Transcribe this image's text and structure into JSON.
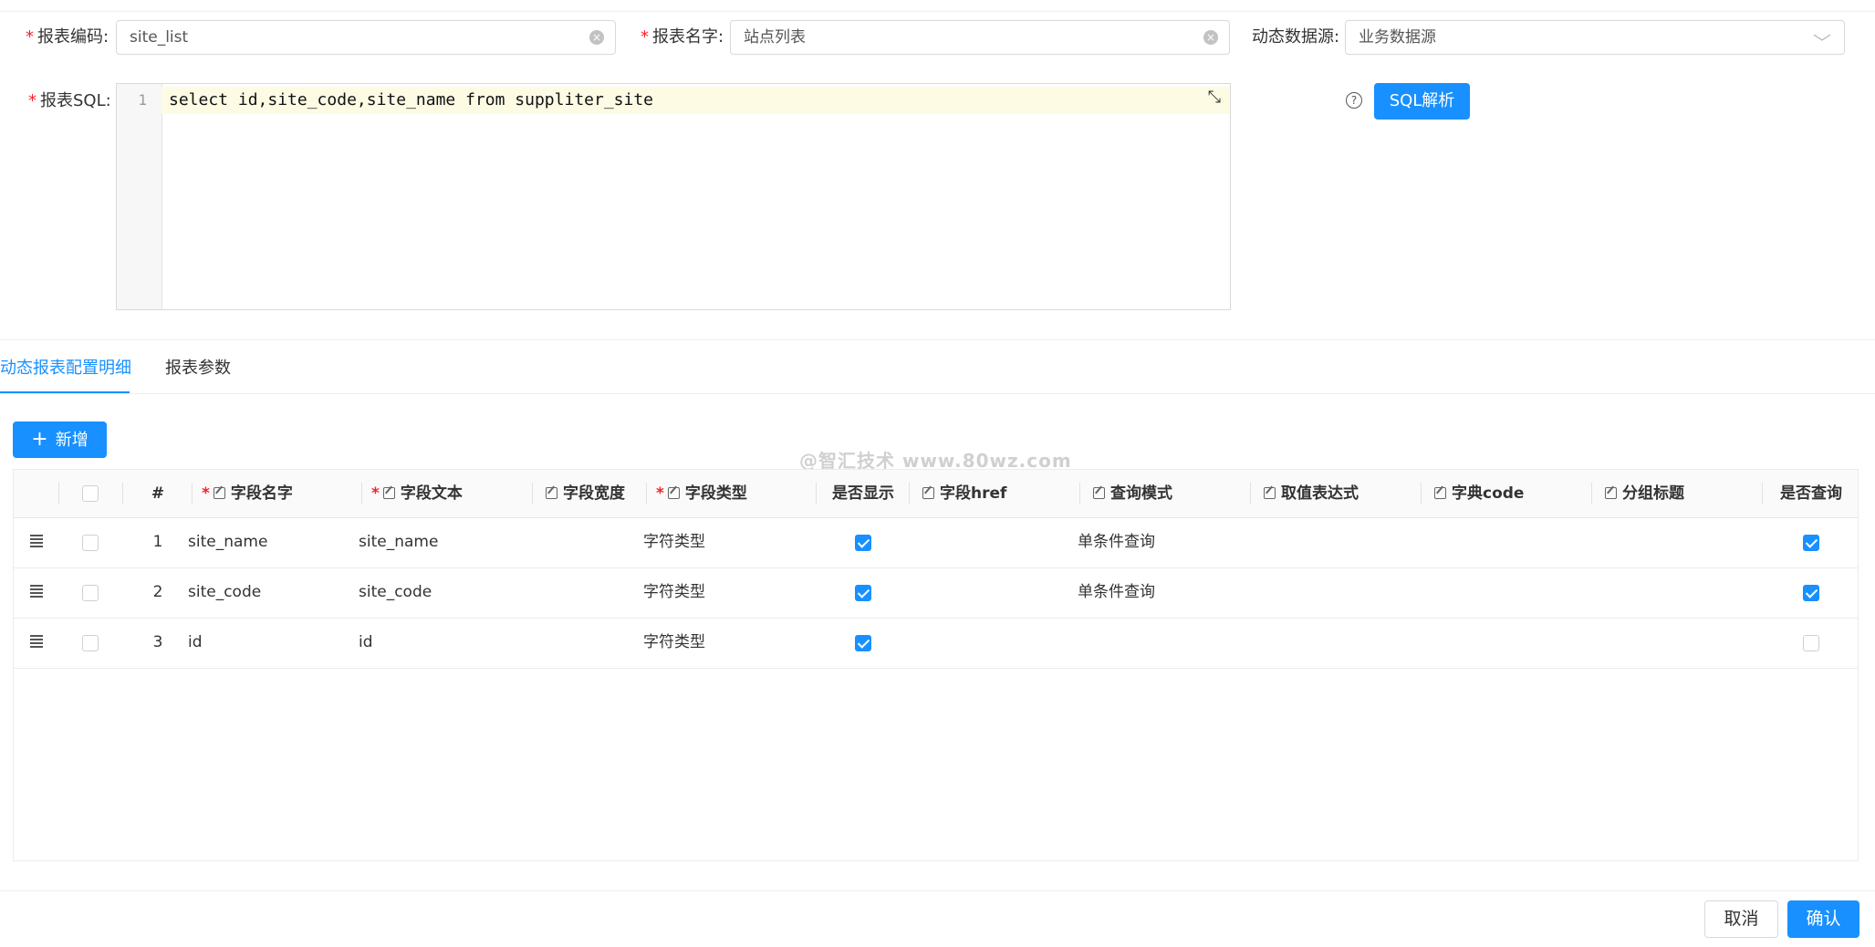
{
  "form": {
    "code_label": "报表编码:",
    "code_value": "site_list",
    "name_label": "报表名字:",
    "name_value": "站点列表",
    "datasource_label": "动态数据源:",
    "datasource_value": "业务数据源",
    "sql_label": "报表SQL:",
    "sql_line_number": "1",
    "sql_code": "select id,site_code,site_name from suppliter_site",
    "parse_button": "SQL解析",
    "help_icon_glyph": "?"
  },
  "tabs": [
    {
      "label": "动态报表配置明细",
      "active": true
    },
    {
      "label": "报表参数",
      "active": false
    }
  ],
  "add_button": "新增",
  "watermark": "@智汇技术 www.80wz.com",
  "table": {
    "headers": {
      "index": "#",
      "field_name": "字段名字",
      "field_text": "字段文本",
      "field_width": "字段宽度",
      "field_type": "字段类型",
      "show": "是否显示",
      "field_href": "字段href",
      "query_mode": "查询模式",
      "expression": "取值表达式",
      "dict_code": "字典code",
      "group_title": "分组标题",
      "is_query": "是否查询"
    },
    "rows": [
      {
        "index": "1",
        "field_name": "site_name",
        "field_text": "site_name",
        "field_type": "字符类型",
        "show": true,
        "query_mode": "单条件查询",
        "is_query": true
      },
      {
        "index": "2",
        "field_name": "site_code",
        "field_text": "site_code",
        "field_type": "字符类型",
        "show": true,
        "query_mode": "单条件查询",
        "is_query": true
      },
      {
        "index": "3",
        "field_name": "id",
        "field_text": "id",
        "field_type": "字符类型",
        "show": true,
        "query_mode": "",
        "is_query": false
      }
    ]
  },
  "footer": {
    "cancel": "取消",
    "confirm": "确认"
  },
  "colors": {
    "primary": "#1890ff",
    "required": "#f5222d",
    "editor_highlight": "#fdfbe4"
  }
}
